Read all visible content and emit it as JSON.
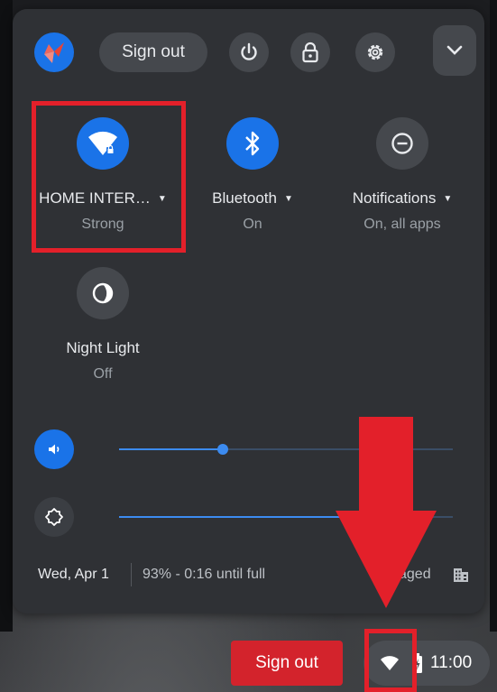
{
  "header": {
    "sign_out_label": "Sign out",
    "icons": [
      "avatar-icon",
      "power-icon",
      "lock-icon",
      "gear-icon",
      "chevron-down-icon"
    ]
  },
  "tiles": {
    "wifi": {
      "label": "HOME INTER…",
      "sub": "Strong",
      "icon": "wifi-lock-icon",
      "active": true
    },
    "bluetooth": {
      "label": "Bluetooth",
      "sub": "On",
      "icon": "bluetooth-icon",
      "active": true
    },
    "notifications": {
      "label": "Notifications",
      "sub": "On, all apps",
      "icon": "do-not-disturb-icon",
      "active": false
    },
    "night_light": {
      "label": "Night Light",
      "sub": "Off",
      "icon": "moon-icon",
      "active": false
    }
  },
  "sliders": {
    "volume": {
      "icon": "volume-icon",
      "level": 0.31
    },
    "brightness": {
      "icon": "brightness-icon",
      "level": 0.75
    }
  },
  "status": {
    "date": "Wed, Apr 1",
    "battery": "93% - 0:16 until full",
    "managed": "aged",
    "managed_icon": "building-icon"
  },
  "shelf": {
    "sign_out_label": "Sign out",
    "time": "11:00",
    "icons": [
      "wifi-icon",
      "battery-charging-icon"
    ]
  },
  "colors": {
    "accent": "#1a73e8",
    "annotation_red": "#e3202a",
    "sign_out_red": "#d3232c",
    "panel_bg": "#2f3135"
  }
}
